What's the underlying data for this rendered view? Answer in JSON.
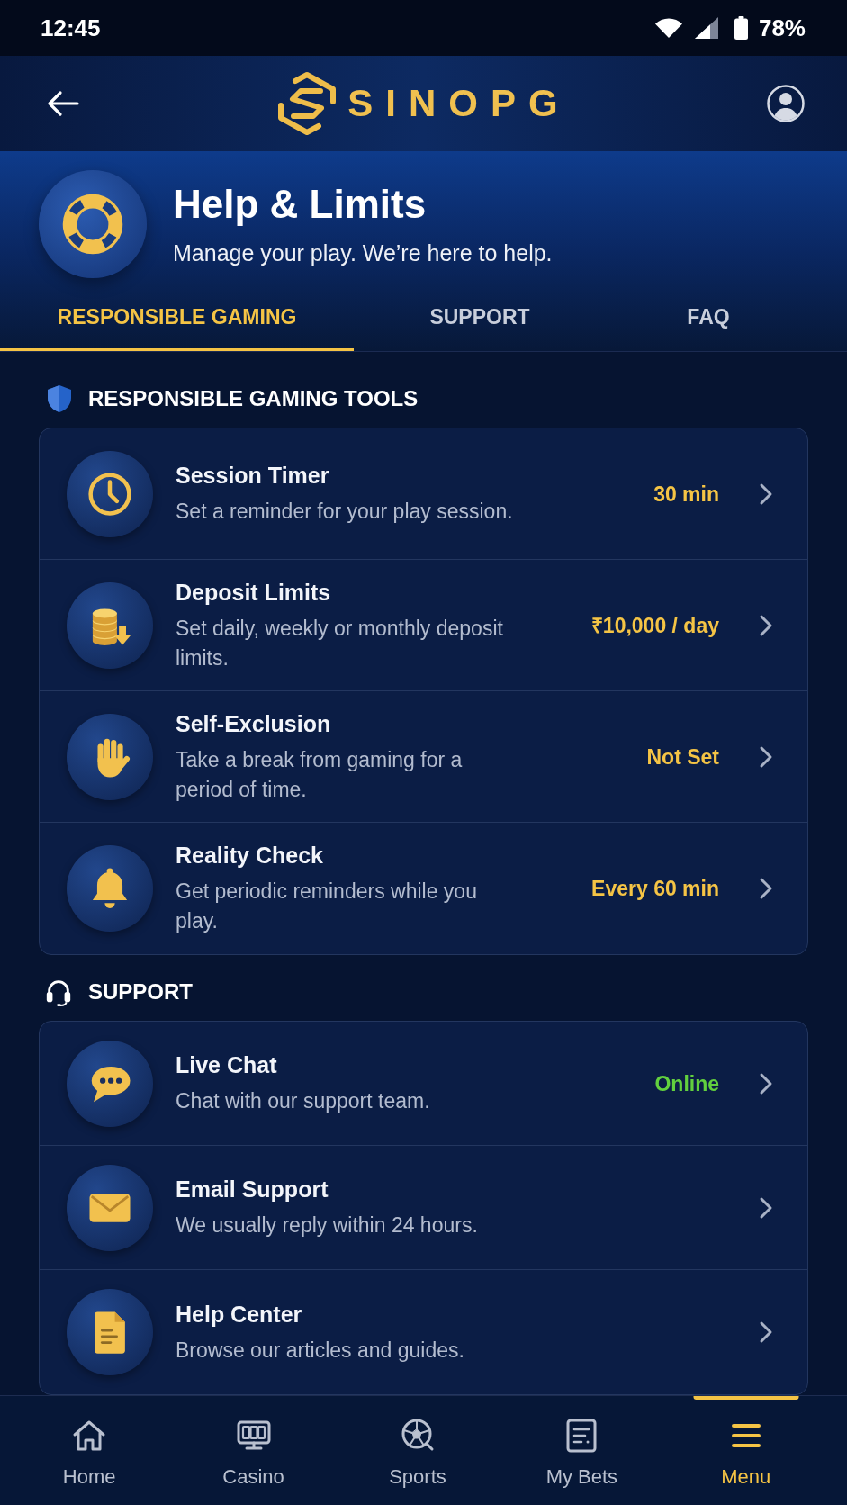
{
  "status_bar": {
    "time": "12:45",
    "battery": "78%"
  },
  "header": {
    "logo": "SINOPG"
  },
  "hero": {
    "title": "Help & Limits",
    "subtitle": "Manage your play. We’re here to help."
  },
  "tabs": [
    {
      "label": "RESPONSIBLE GAMING",
      "selected": true
    },
    {
      "label": "SUPPORT",
      "selected": false
    },
    {
      "label": "FAQ",
      "selected": false
    }
  ],
  "sections": [
    {
      "kind": "shield",
      "title": "RESPONSIBLE GAMING TOOLS",
      "items": [
        {
          "kind": "clock",
          "title": "Session Timer",
          "description": "Set a reminder for your play session.",
          "value": "30 min",
          "color": "#f5c445"
        },
        {
          "kind": "coins",
          "title": "Deposit Limits",
          "description": "Set daily, weekly or monthly deposit limits.",
          "value": "₹10,000 / day",
          "color": "#f5c445"
        },
        {
          "kind": "hand",
          "title": "Self-Exclusion",
          "description": "Take a break from gaming for a period of time.",
          "value": "Not Set",
          "color": "#f5c445"
        },
        {
          "kind": "bell",
          "title": "Reality Check",
          "description": "Get periodic reminders while you play.",
          "value": "Every 60 min",
          "color": "#f5c445"
        }
      ]
    },
    {
      "kind": "headset",
      "title": "SUPPORT",
      "items": [
        {
          "kind": "chat",
          "title": "Live Chat",
          "description": "Chat with our support team.",
          "value": "Online",
          "color": "#62d03e"
        },
        {
          "kind": "mail",
          "title": "Email Support",
          "description": "We usually reply within 24 hours."
        },
        {
          "kind": "document",
          "title": "Help Center",
          "description": "Browse our articles and guides."
        }
      ]
    }
  ],
  "nav": [
    {
      "kind": "home",
      "label": "Home",
      "selected": false
    },
    {
      "kind": "casino",
      "label": "Casino",
      "selected": false
    },
    {
      "kind": "sports",
      "label": "Sports",
      "selected": false
    },
    {
      "kind": "bets",
      "label": "My Bets",
      "selected": false
    },
    {
      "kind": "menu",
      "label": "Menu",
      "selected": true
    }
  ]
}
